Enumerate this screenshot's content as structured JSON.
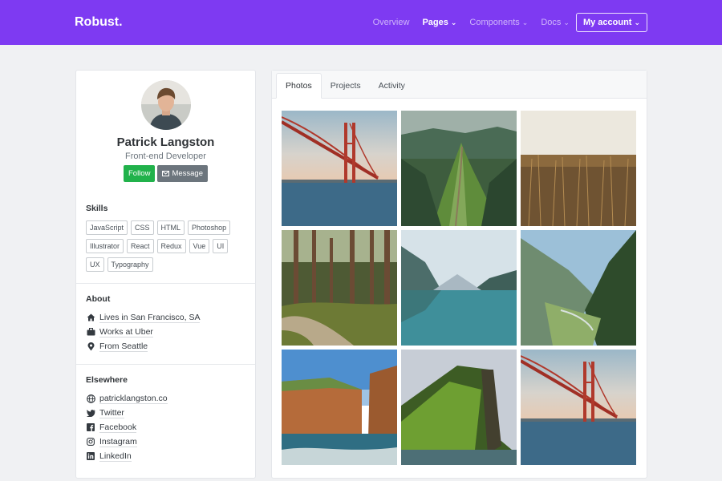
{
  "navbar": {
    "brand": "Robust.",
    "links": [
      {
        "label": "Overview",
        "caret": false
      },
      {
        "label": "Pages",
        "caret": true,
        "active": true
      },
      {
        "label": "Components",
        "caret": true
      },
      {
        "label": "Docs",
        "caret": true
      }
    ],
    "account_label": "My account",
    "accent_color": "#7e3af2"
  },
  "profile": {
    "name": "Patrick Langston",
    "role": "Front-end Developer",
    "follow_label": "Follow",
    "message_label": "Message"
  },
  "skills": {
    "title": "Skills",
    "items": [
      "JavaScript",
      "CSS",
      "HTML",
      "Photoshop",
      "Illustrator",
      "React",
      "Redux",
      "Vue",
      "UI",
      "UX",
      "Typography"
    ]
  },
  "about": {
    "title": "About",
    "items": [
      {
        "icon": "home-icon",
        "prefix": "Lives in ",
        "link": "San Francisco, SA"
      },
      {
        "icon": "briefcase-icon",
        "prefix": "Works at ",
        "link": "Uber"
      },
      {
        "icon": "map-pin-icon",
        "prefix": "From ",
        "link": "Seattle"
      }
    ]
  },
  "elsewhere": {
    "title": "Elsewhere",
    "items": [
      {
        "icon": "globe-icon",
        "label": "patricklangston.co"
      },
      {
        "icon": "twitter-icon",
        "label": "Twitter"
      },
      {
        "icon": "facebook-icon",
        "label": "Facebook"
      },
      {
        "icon": "instagram-icon",
        "label": "Instagram"
      },
      {
        "icon": "linkedin-icon",
        "label": "LinkedIn"
      }
    ]
  },
  "tabs": [
    {
      "label": "Photos",
      "active": true
    },
    {
      "label": "Projects"
    },
    {
      "label": "Activity"
    }
  ]
}
